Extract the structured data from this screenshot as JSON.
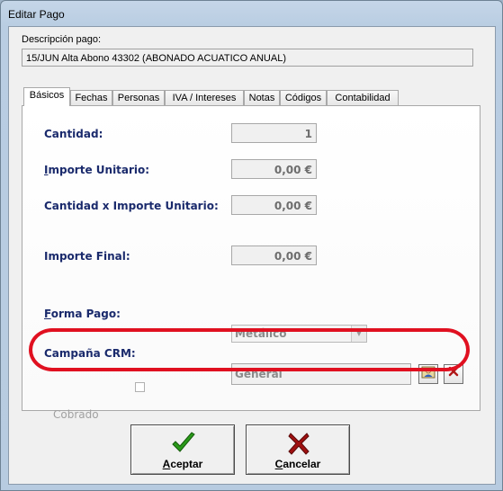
{
  "window": {
    "title": "Editar Pago"
  },
  "description": {
    "label": "Descripción pago:",
    "value": "15/JUN Alta Abono 43302 (ABONADO ACUATICO ANUAL)"
  },
  "tabs": [
    {
      "label": "Básicos",
      "active": true
    },
    {
      "label": "Fechas",
      "active": false
    },
    {
      "label": "Personas",
      "active": false
    },
    {
      "label": "IVA / Intereses",
      "active": false
    },
    {
      "label": "Notas",
      "active": false
    },
    {
      "label": "Códigos",
      "active": false
    },
    {
      "label": "Contabilidad",
      "active": false
    }
  ],
  "fields": {
    "cantidad": {
      "label": "Cantidad:",
      "value": "1"
    },
    "importe_unitario": {
      "label_u": "I",
      "label_rest": "mporte Unitario:",
      "value": "0,00 €"
    },
    "cantidad_x_importe": {
      "label": "Cantidad x Importe Unitario:",
      "value": "0,00 €"
    },
    "importe_final": {
      "label": "Importe Final:",
      "value": "0,00 €"
    },
    "forma_pago": {
      "label_u": "F",
      "label_rest": "orma Pago:",
      "value": "Metálico"
    },
    "campana_crm": {
      "label": "Campaña CRM:",
      "value": "General"
    },
    "cobrado": {
      "label": "Cobrado",
      "checked": false
    }
  },
  "buttons": {
    "accept": {
      "label_u": "A",
      "label_rest": "ceptar"
    },
    "cancel": {
      "label_u": "C",
      "label_rest": "ancelar"
    }
  },
  "colors": {
    "label_blue": "#1a2a6c",
    "highlight_red": "#e01020",
    "check_green": "#2a9a1a",
    "cancel_red": "#a01010"
  }
}
